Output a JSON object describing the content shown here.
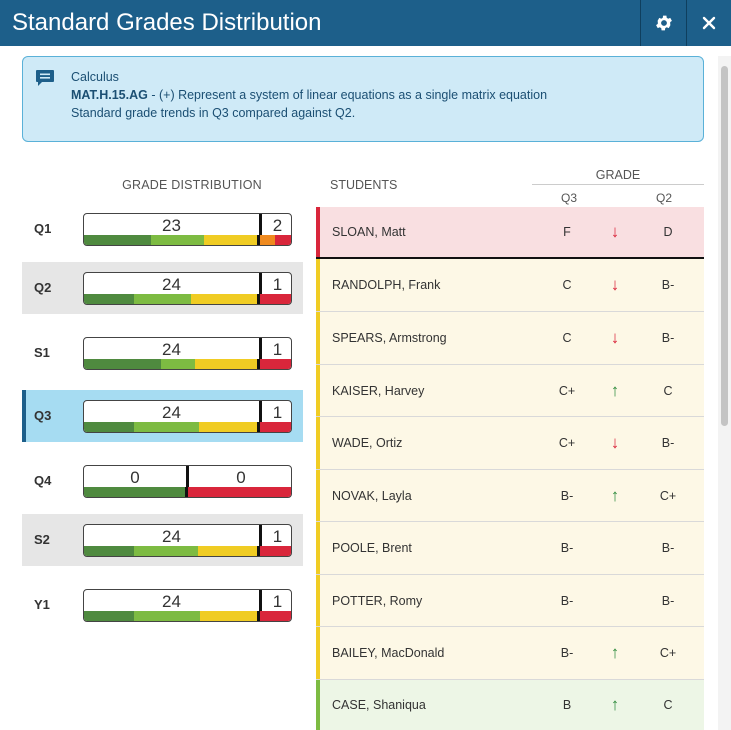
{
  "window": {
    "title": "Standard Grades Distribution"
  },
  "banner": {
    "subject": "Calculus",
    "standard_code": "MAT.H.15.AG",
    "standard_desc": " - (+) Represent a system of linear equations as a single matrix equation",
    "trend_text": "Standard grade trends in Q3 compared against Q2."
  },
  "distribution": {
    "header": "GRADE DISTRIBUTION",
    "rows": [
      {
        "period": "Q1",
        "left_count": "23",
        "right_count": "2",
        "state": "normal"
      },
      {
        "period": "Q2",
        "left_count": "24",
        "right_count": "1",
        "state": "shaded"
      },
      {
        "period": "S1",
        "left_count": "24",
        "right_count": "1",
        "state": "normal"
      },
      {
        "period": "Q3",
        "left_count": "24",
        "right_count": "1",
        "state": "selected"
      },
      {
        "period": "Q4",
        "left_count": "0",
        "right_count": "0",
        "state": "normal"
      },
      {
        "period": "S2",
        "left_count": "24",
        "right_count": "1",
        "state": "shaded"
      },
      {
        "period": "Y1",
        "left_count": "24",
        "right_count": "1",
        "state": "normal"
      }
    ]
  },
  "students_table": {
    "students_header": "STUDENTS",
    "grade_header": "GRADE",
    "col_q3": "Q3",
    "col_q2": "Q2",
    "rows": [
      {
        "name": "SLOAN, Matt",
        "q3": "F",
        "trend": "down",
        "q2": "D"
      },
      {
        "name": "RANDOLPH, Frank",
        "q3": "C",
        "trend": "down",
        "q2": "B-"
      },
      {
        "name": "SPEARS, Armstrong",
        "q3": "C",
        "trend": "down",
        "q2": "B-"
      },
      {
        "name": "KAISER, Harvey",
        "q3": "C+",
        "trend": "up",
        "q2": "C"
      },
      {
        "name": "WADE, Ortiz",
        "q3": "C+",
        "trend": "down",
        "q2": "B-"
      },
      {
        "name": "NOVAK, Layla",
        "q3": "B-",
        "trend": "up",
        "q2": "C+"
      },
      {
        "name": "POOLE, Brent",
        "q3": "B-",
        "trend": "none",
        "q2": "B-"
      },
      {
        "name": "POTTER, Romy",
        "q3": "B-",
        "trend": "none",
        "q2": "B-"
      },
      {
        "name": "BAILEY, MacDonald",
        "q3": "B-",
        "trend": "up",
        "q2": "C+"
      },
      {
        "name": "CASE, Shaniqua",
        "q3": "B",
        "trend": "up",
        "q2": "C"
      }
    ]
  },
  "colors": {
    "header_bg": "#1d5f8a",
    "banner_bg": "#cfeaf7",
    "selected_row": "#a6dcf2",
    "grade_dark_green": "#4f8a3f",
    "grade_light_green": "#7dbb42",
    "grade_yellow": "#f0cc23",
    "grade_orange": "#ef8a1f",
    "grade_red": "#d9263b",
    "trend_down": "#d9263b",
    "trend_up": "#2e8b3c"
  },
  "icons": {
    "gear": "gear-icon",
    "close": "close-icon",
    "banner": "chat-icon",
    "trend_up": "arrow-up-icon",
    "trend_down": "arrow-down-icon"
  }
}
